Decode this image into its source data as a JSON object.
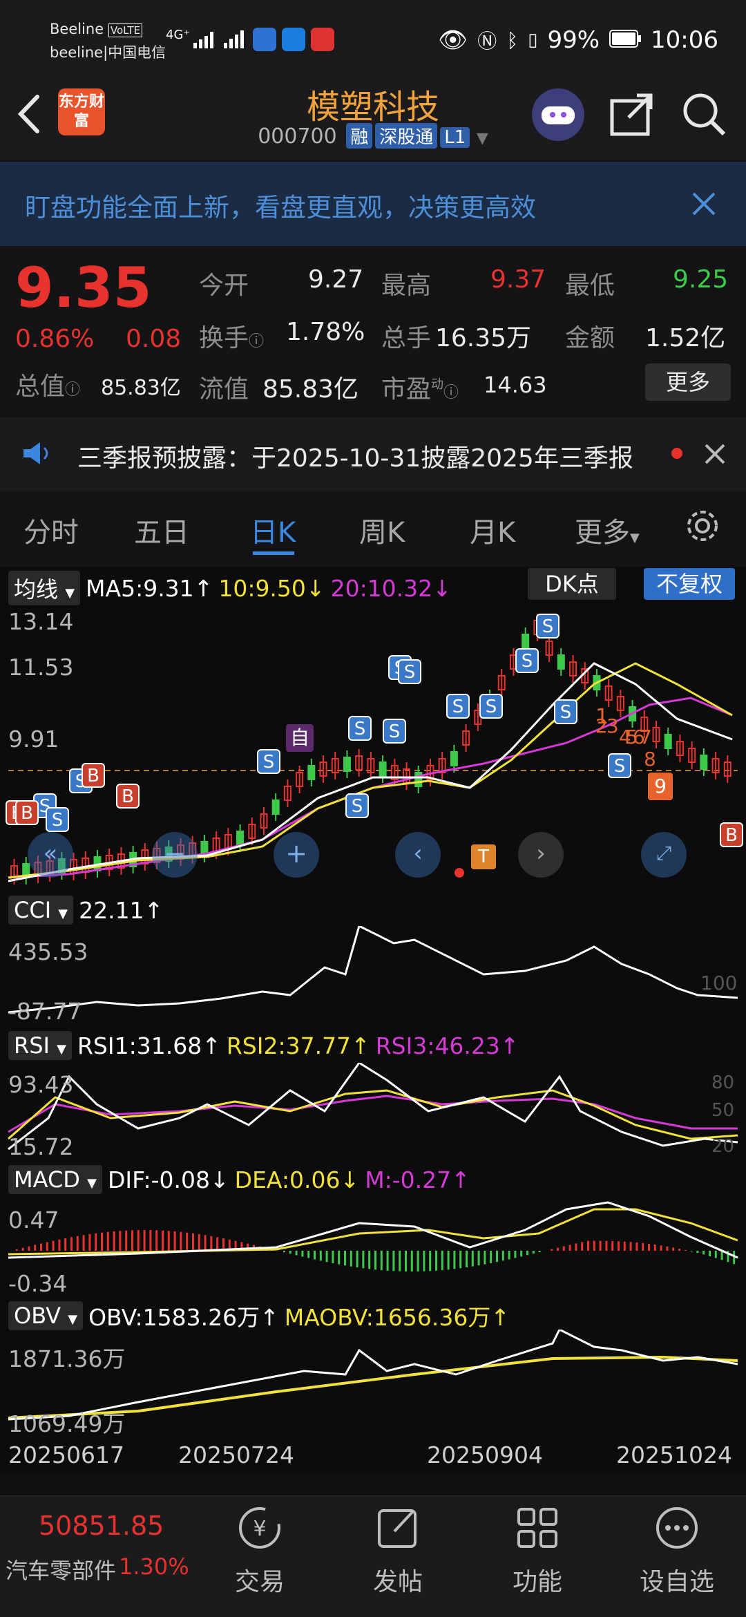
{
  "status": {
    "carrier1": "Beeline",
    "carrier1_badge": "VoLTE",
    "carrier2": "beeline|中国电信",
    "net": "4G⁺",
    "battery": "99%",
    "time": "10:06"
  },
  "header": {
    "logo": "东方财富",
    "title": "模塑科技",
    "code": "000700",
    "tags": [
      "融",
      "深股通",
      "L1"
    ]
  },
  "banner": {
    "text": "盯盘功能全面上新，看盘更直观，决策更高效"
  },
  "quote": {
    "price": "9.35",
    "change_pct": "0.86%",
    "change": "0.08",
    "open_label": "今开",
    "open": "9.27",
    "high_label": "最高",
    "high": "9.37",
    "low_label": "最低",
    "low": "9.25",
    "turnover_label": "换手",
    "turnover": "1.78%",
    "volume_label": "总手",
    "volume": "16.35万",
    "amount_label": "金额",
    "amount": "1.52亿",
    "mktcap_label": "总值",
    "mktcap": "85.83亿",
    "float_label": "流值",
    "float": "85.83亿",
    "pe_label": "市盈",
    "pe_sup": "动",
    "pe": "14.63",
    "more": "更多"
  },
  "notice": {
    "text": "三季报预披露：于2025-10-31披露2025年三季报"
  },
  "tabs": [
    "分时",
    "五日",
    "日K",
    "周K",
    "月K",
    "更多"
  ],
  "active_tab": "日K",
  "kline": {
    "selector": "均线",
    "ma5": "MA5:9.31",
    "ma10": "10:9.50",
    "ma20": "20:10.32",
    "dk_button": "DK点",
    "fq_button": "不复权",
    "y_labels": [
      "13.14",
      "11.53",
      "9.91"
    ],
    "self_marker": "自",
    "t_marker": "T",
    "nine_marker": "9",
    "seq_markers": [
      "1",
      "2",
      "3",
      "4",
      "5",
      "6",
      "7",
      "8"
    ]
  },
  "cci": {
    "selector": "CCI",
    "value": "22.11",
    "y_top": "435.53",
    "y_bottom": "-87.77",
    "ref": "100"
  },
  "rsi": {
    "selector": "RSI",
    "rsi1": "RSI1:31.68",
    "rsi2": "RSI2:37.77",
    "rsi3": "RSI3:46.23",
    "y_top": "93.43",
    "y_bottom": "15.72",
    "ref_top": "80",
    "ref_mid": "50",
    "ref_bottom": "20"
  },
  "macd": {
    "selector": "MACD",
    "dif": "DIF:-0.08",
    "dea": "DEA:0.06",
    "m": "M:-0.27",
    "y_top": "0.47",
    "y_bottom": "-0.34"
  },
  "obv": {
    "selector": "OBV",
    "obv": "OBV:1583.26万",
    "maobv": "MAOBV:1656.36万",
    "y_top": "1871.36万",
    "y_bottom": "1069.49万"
  },
  "x_dates": [
    "20250617",
    "20250724",
    "20250904",
    "20251024"
  ],
  "bottom_nav": {
    "index_value": "50851.85",
    "index_name": "汽车零部件",
    "index_change": "1.30%",
    "items": [
      "交易",
      "发帖",
      "功能",
      "设自选"
    ]
  },
  "colors": {
    "up": "#e8322d",
    "down": "#3ec94a",
    "ma5": "#ffffff",
    "ma10": "#f2e13a",
    "ma20": "#d63ad6",
    "accent": "#3a87e0",
    "brand": "#f2a23c"
  }
}
